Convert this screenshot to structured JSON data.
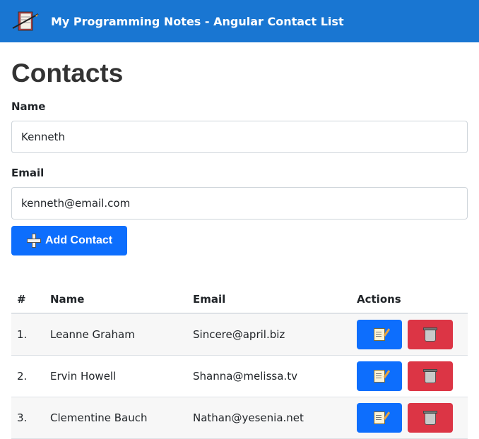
{
  "header": {
    "title": "My Programming Notes - Angular Contact List"
  },
  "page": {
    "heading": "Contacts"
  },
  "form": {
    "name_label": "Name",
    "name_value": "Kenneth",
    "email_label": "Email",
    "email_value": "kenneth@email.com",
    "add_button_label": "Add Contact",
    "add_button_icon": "plus-icon"
  },
  "table": {
    "headers": [
      "#",
      "Name",
      "Email",
      "Actions"
    ],
    "rows": [
      {
        "num": "1.",
        "name": "Leanne Graham",
        "email": "Sincere@april.biz"
      },
      {
        "num": "2.",
        "name": "Ervin Howell",
        "email": "Shanna@melissa.tv"
      },
      {
        "num": "3.",
        "name": "Clementine Bauch",
        "email": "Nathan@yesenia.net"
      }
    ],
    "edit_icon": "memo-icon",
    "delete_icon": "wastebasket-icon"
  },
  "colors": {
    "header_bg": "#1976d2",
    "primary": "#0d6efd",
    "danger": "#dc3545"
  }
}
